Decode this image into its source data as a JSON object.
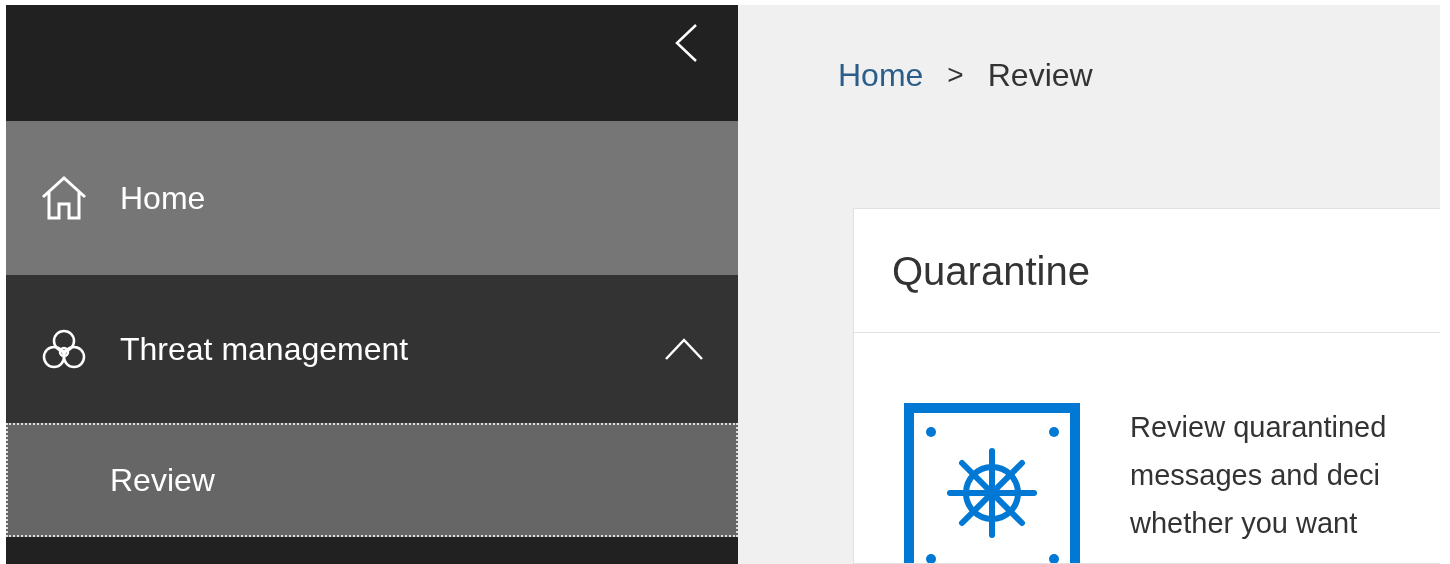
{
  "sidebar": {
    "items": [
      {
        "kind": "link",
        "label": "Home",
        "selected": false
      },
      {
        "kind": "group",
        "label": "Threat management",
        "expanded": true,
        "children": [
          {
            "label": "Review",
            "selected": true
          }
        ]
      }
    ]
  },
  "breadcrumb": [
    {
      "label": "Home"
    },
    {
      "label": "Review"
    }
  ],
  "breadcrumb_separator": ">",
  "card": {
    "title": "Quarantine",
    "description_lines": [
      "Review quarantined",
      "messages and deci",
      "whether you want"
    ]
  }
}
